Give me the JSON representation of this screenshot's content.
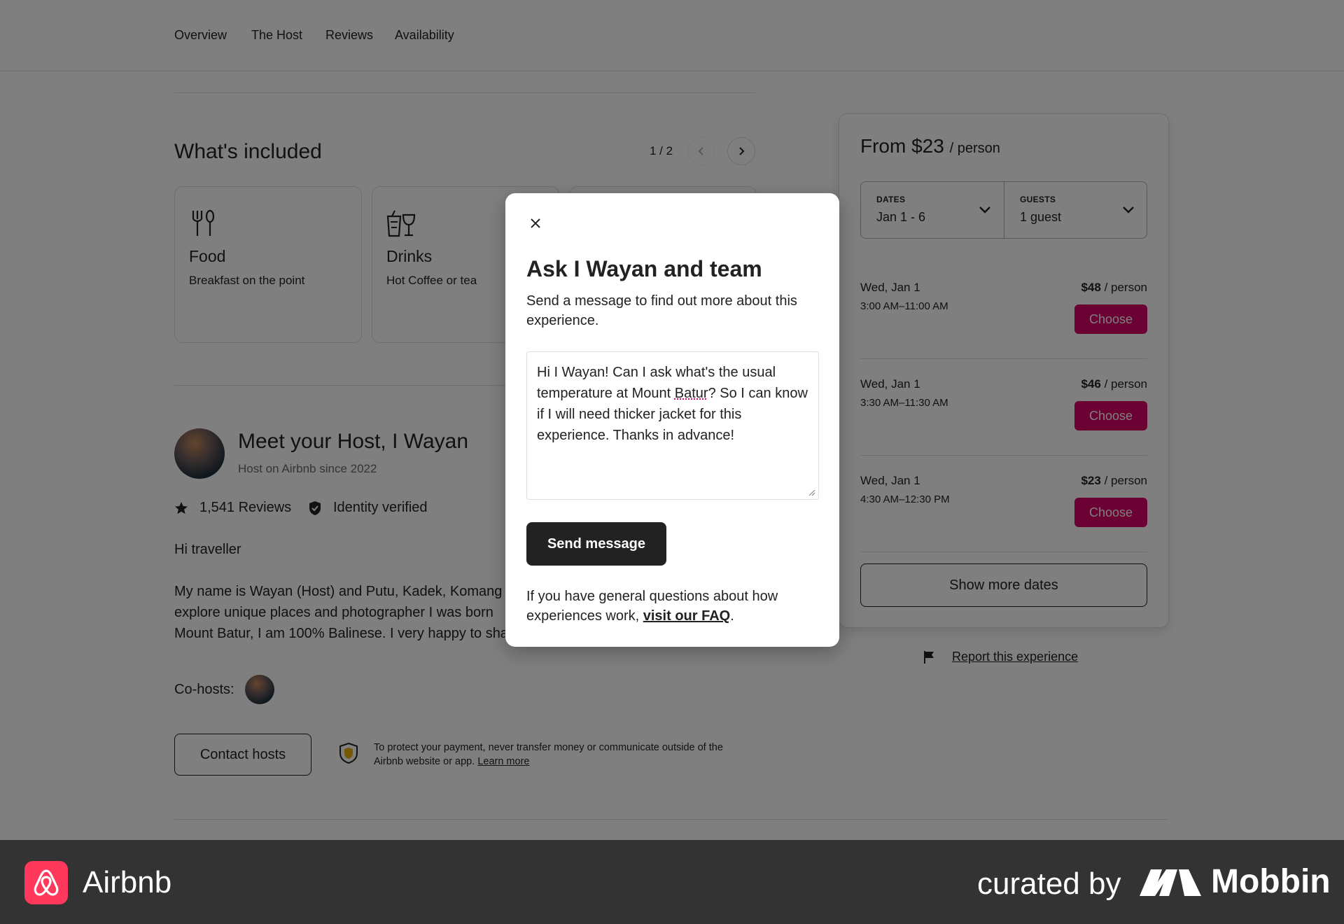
{
  "subnav": {
    "items": [
      "Overview",
      "The Host",
      "Reviews",
      "Availability"
    ]
  },
  "included": {
    "title": "What's included",
    "pager": "1 / 2",
    "cards": [
      {
        "title": "Food",
        "subtitle": "Breakfast on the point",
        "icon": "utensils-icon"
      },
      {
        "title": "Drinks",
        "subtitle": "Hot Coffee or tea",
        "icon": "drinks-icon"
      }
    ]
  },
  "host": {
    "title": "Meet your Host, I Wayan",
    "since": "Host on Airbnb since 2022",
    "reviews": "1,541 Reviews",
    "verified": "Identity verified",
    "greeting": "Hi traveller",
    "bio_lines": [
      "My name is Wayan (Host) and Putu, Kadek, Komang",
      "explore unique places and photographer I was born",
      "Mount Batur, I am 100% Balinese. I very happy to sha"
    ],
    "cohosts_label": "Co-hosts:",
    "contact_label": "Contact hosts",
    "protect_text": "To protect your payment, never transfer money or communicate outside of the Airbnb website or app.",
    "learn_more": "Learn more"
  },
  "booking": {
    "from_label": "From $23",
    "per_label": "/ person",
    "dates_label": "DATES",
    "dates_value": "Jan 1 - 6",
    "guests_label": "GUESTS",
    "guests_value": "1 guest",
    "slots": [
      {
        "day": "Wed, Jan 1",
        "time": "3:00 AM–11:00 AM",
        "price": "$48",
        "per": "/ person",
        "button": "Choose"
      },
      {
        "day": "Wed, Jan 1",
        "time": "3:30 AM–11:30 AM",
        "price": "$46",
        "per": "/ person",
        "button": "Choose"
      },
      {
        "day": "Wed, Jan 1",
        "time": "4:30 AM–12:30 PM",
        "price": "$23",
        "per": "/ person",
        "button": "Choose"
      }
    ],
    "more_dates": "Show more dates",
    "report": "Report this experience"
  },
  "modal": {
    "title": "Ask I Wayan and team",
    "description": "Send a message to find out more about this experience.",
    "message_part1": "Hi I Wayan! Can I ask what's the usual temperature at Mount ",
    "message_misspelled": "Batur",
    "message_part2": "? So I can know if I will need thicker jacket for this experience. Thanks in advance!",
    "send_label": "Send message",
    "faq_text": "If you have general questions about how experiences work, ",
    "faq_link": "visit our FAQ",
    "faq_end": "."
  },
  "footer": {
    "brand": "Airbnb",
    "curated": "curated by",
    "mobbin": "Mobbin"
  },
  "colors": {
    "accent": "#d70466",
    "brand": "#ff385c",
    "dark": "#222222",
    "footer_bg": "#333333"
  }
}
